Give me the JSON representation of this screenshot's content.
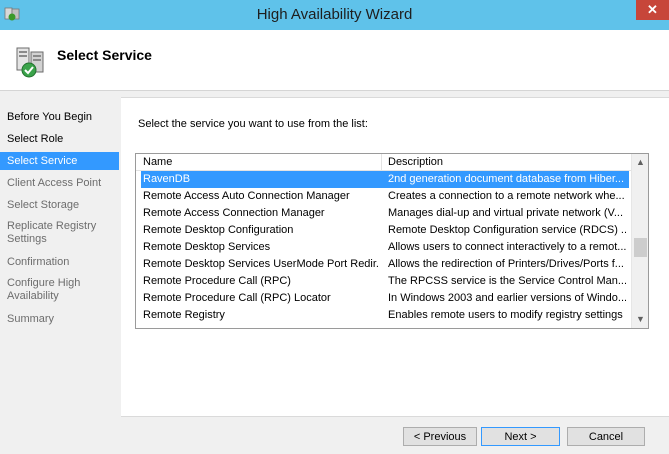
{
  "window": {
    "title": "High Availability Wizard",
    "close_glyph": "✕"
  },
  "header": {
    "title": "Select Service",
    "icon": "server-wizard-icon"
  },
  "sidebar": {
    "items": [
      {
        "label": "Before You Begin",
        "state": "done"
      },
      {
        "label": "Select Role",
        "state": "done"
      },
      {
        "label": "Select Service",
        "state": "active"
      },
      {
        "label": "Client Access Point",
        "state": "future"
      },
      {
        "label": "Select Storage",
        "state": "future"
      },
      {
        "label": "Replicate Registry Settings",
        "state": "future"
      },
      {
        "label": "Confirmation",
        "state": "future"
      },
      {
        "label": "Configure High Availability",
        "state": "future"
      },
      {
        "label": "Summary",
        "state": "future"
      }
    ]
  },
  "main": {
    "instruction": "Select the service you want to use from the list:",
    "columns": {
      "name": "Name",
      "description": "Description"
    },
    "rows": [
      {
        "name": "RavenDB",
        "description": "2nd generation document database from Hiber...",
        "selected": true
      },
      {
        "name": "Remote Access Auto Connection Manager",
        "description": "Creates a connection to a remote network whe..."
      },
      {
        "name": "Remote Access Connection Manager",
        "description": "Manages dial-up and virtual private network (V..."
      },
      {
        "name": "Remote Desktop Configuration",
        "description": "Remote Desktop Configuration service (RDCS) ..."
      },
      {
        "name": "Remote Desktop Services",
        "description": "Allows users to connect interactively to a remot..."
      },
      {
        "name": "Remote Desktop Services UserMode Port Redir...",
        "description": "Allows the redirection of Printers/Drives/Ports f..."
      },
      {
        "name": "Remote Procedure Call (RPC)",
        "description": "The RPCSS service is the Service Control Man..."
      },
      {
        "name": "Remote Procedure Call (RPC) Locator",
        "description": "In Windows 2003 and earlier versions of Windo..."
      },
      {
        "name": "Remote Registry",
        "description": "Enables remote users to modify registry settings ..."
      }
    ]
  },
  "buttons": {
    "previous": "< Previous",
    "next": "Next >",
    "cancel": "Cancel"
  },
  "colors": {
    "titlebar": "#5fc2ea",
    "selection": "#3399ff",
    "close": "#c7463a"
  }
}
